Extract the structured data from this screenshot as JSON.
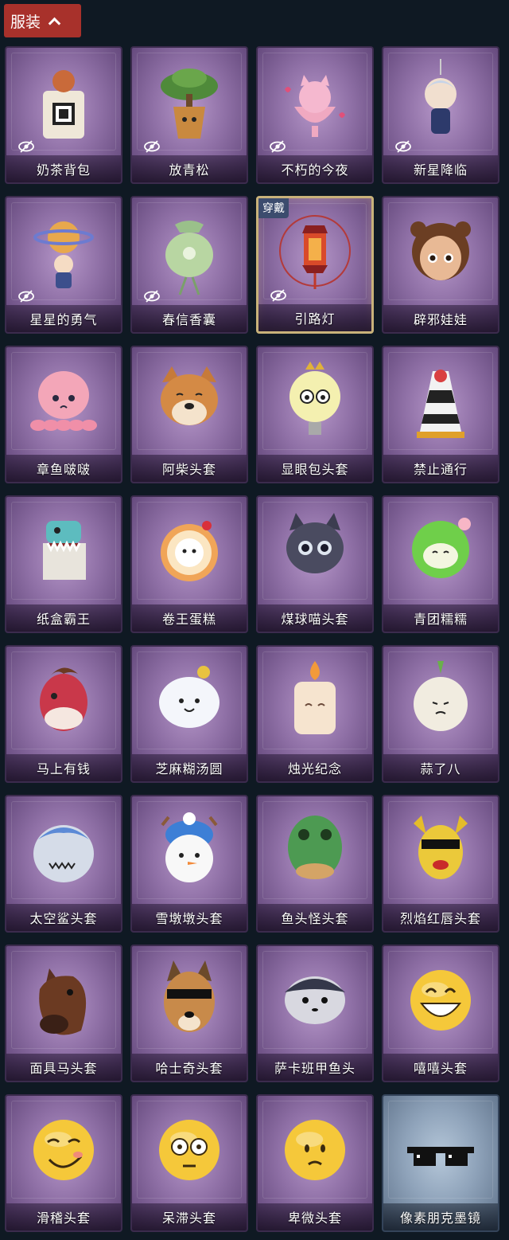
{
  "header": {
    "tab_label": "服装",
    "icon": "chevron-up-icon"
  },
  "badge_label": "穿戴",
  "items": [
    {
      "label": "奶茶背包",
      "art": "milk-tea-backpack",
      "hidden": true
    },
    {
      "label": "放青松",
      "art": "bonsai-pine",
      "hidden": true
    },
    {
      "label": "不朽的今夜",
      "art": "pink-cat-cup",
      "hidden": true
    },
    {
      "label": "新星降临",
      "art": "star-charm",
      "hidden": true
    },
    {
      "label": "星星的勇气",
      "art": "planet-charm",
      "hidden": true
    },
    {
      "label": "春信香囊",
      "art": "green-sachet",
      "hidden": true
    },
    {
      "label": "引路灯",
      "art": "red-lantern",
      "hidden": true,
      "equipped": true
    },
    {
      "label": "辟邪娃娃",
      "art": "doll-head",
      "hidden": false
    },
    {
      "label": "章鱼啵啵",
      "art": "pink-octopus",
      "hidden": false
    },
    {
      "label": "阿柴头套",
      "art": "shiba-head",
      "hidden": false
    },
    {
      "label": "显眼包头套",
      "art": "lightbulb-head",
      "hidden": false
    },
    {
      "label": "禁止通行",
      "art": "traffic-cone",
      "hidden": false
    },
    {
      "label": "纸盒霸王",
      "art": "box-dino",
      "hidden": false
    },
    {
      "label": "卷王蛋糕",
      "art": "roll-cake",
      "hidden": false
    },
    {
      "label": "煤球喵头套",
      "art": "black-cat",
      "hidden": false
    },
    {
      "label": "青团糯糯",
      "art": "green-rice-ball",
      "hidden": false
    },
    {
      "label": "马上有钱",
      "art": "red-horse",
      "hidden": false
    },
    {
      "label": "芝麻糊汤圆",
      "art": "white-dumpling",
      "hidden": false
    },
    {
      "label": "烛光纪念",
      "art": "candle",
      "hidden": false
    },
    {
      "label": "蒜了八",
      "art": "garlic",
      "hidden": false
    },
    {
      "label": "太空鲨头套",
      "art": "shark",
      "hidden": false
    },
    {
      "label": "雪墩墩头套",
      "art": "snowman",
      "hidden": false
    },
    {
      "label": "鱼头怪头套",
      "art": "fish-head",
      "hidden": false
    },
    {
      "label": "烈焰红唇头套",
      "art": "yellow-pika",
      "hidden": false
    },
    {
      "label": "面具马头套",
      "art": "horse-mask",
      "hidden": false
    },
    {
      "label": "哈士奇头套",
      "art": "husky",
      "hidden": false
    },
    {
      "label": "萨卡班甲鱼头",
      "art": "sacabambaspis",
      "hidden": false
    },
    {
      "label": "嘻嘻头套",
      "art": "grin-emoji",
      "hidden": false
    },
    {
      "label": "滑稽头套",
      "art": "funny-emoji",
      "hidden": false
    },
    {
      "label": "呆滞头套",
      "art": "stare-emoji",
      "hidden": false
    },
    {
      "label": "卑微头套",
      "art": "humble-emoji",
      "hidden": false
    },
    {
      "label": "像素朋克墨镜",
      "art": "pixel-sunglasses",
      "hidden": false,
      "theme": "blue"
    }
  ]
}
